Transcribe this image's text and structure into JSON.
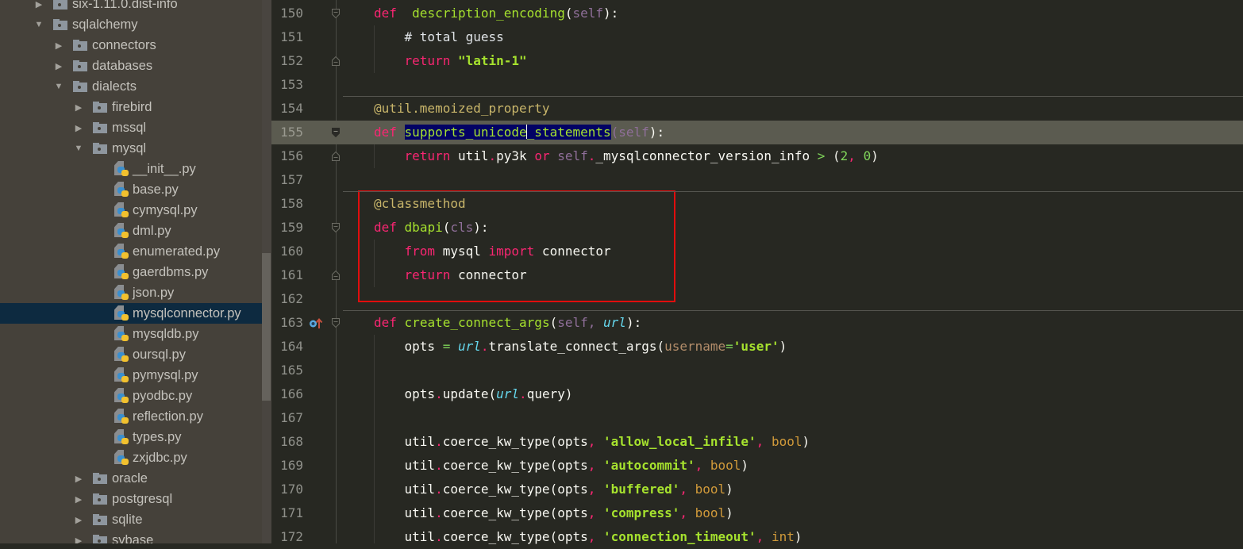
{
  "project_tree": {
    "items": [
      {
        "label": "six-1.11.0.dist-info",
        "type": "folder",
        "expanded": false,
        "depth": 0
      },
      {
        "label": "sqlalchemy",
        "type": "folder",
        "expanded": true,
        "depth": 0
      },
      {
        "label": "connectors",
        "type": "folder",
        "expanded": false,
        "depth": 1
      },
      {
        "label": "databases",
        "type": "folder",
        "expanded": false,
        "depth": 1
      },
      {
        "label": "dialects",
        "type": "folder",
        "expanded": true,
        "depth": 1
      },
      {
        "label": "firebird",
        "type": "folder",
        "expanded": false,
        "depth": 2
      },
      {
        "label": "mssql",
        "type": "folder",
        "expanded": false,
        "depth": 2
      },
      {
        "label": "mysql",
        "type": "folder",
        "expanded": true,
        "depth": 2
      },
      {
        "label": "__init__.py",
        "type": "file",
        "depth": 3
      },
      {
        "label": "base.py",
        "type": "file",
        "depth": 3
      },
      {
        "label": "cymysql.py",
        "type": "file",
        "depth": 3
      },
      {
        "label": "dml.py",
        "type": "file",
        "depth": 3
      },
      {
        "label": "enumerated.py",
        "type": "file",
        "depth": 3
      },
      {
        "label": "gaerdbms.py",
        "type": "file",
        "depth": 3
      },
      {
        "label": "json.py",
        "type": "file",
        "depth": 3
      },
      {
        "label": "mysqlconnector.py",
        "type": "file",
        "depth": 3,
        "selected": true
      },
      {
        "label": "mysqldb.py",
        "type": "file",
        "depth": 3
      },
      {
        "label": "oursql.py",
        "type": "file",
        "depth": 3
      },
      {
        "label": "pymysql.py",
        "type": "file",
        "depth": 3
      },
      {
        "label": "pyodbc.py",
        "type": "file",
        "depth": 3
      },
      {
        "label": "reflection.py",
        "type": "file",
        "depth": 3
      },
      {
        "label": "types.py",
        "type": "file",
        "depth": 3
      },
      {
        "label": "zxjdbc.py",
        "type": "file",
        "depth": 3
      },
      {
        "label": "oracle",
        "type": "folder",
        "expanded": false,
        "depth": 2
      },
      {
        "label": "postgresql",
        "type": "folder",
        "expanded": false,
        "depth": 2
      },
      {
        "label": "sqlite",
        "type": "folder",
        "expanded": false,
        "depth": 2
      },
      {
        "label": "sybase",
        "type": "folder",
        "expanded": false,
        "depth": 2
      }
    ]
  },
  "editor": {
    "current_line": 155,
    "highlight_color": "#e20d0d",
    "lines": [
      {
        "n": "150",
        "tokens": [
          [
            "kw",
            "def"
          ],
          [
            "",
            "  "
          ],
          [
            "fn",
            "description_encoding"
          ],
          [
            "",
            "("
          ],
          [
            "self",
            "self"
          ],
          [
            "",
            "):"
          ]
        ]
      },
      {
        "n": "151",
        "tokens": [
          [
            "",
            "    "
          ],
          [
            "cmt",
            "# total guess"
          ]
        ]
      },
      {
        "n": "152",
        "tokens": [
          [
            "",
            "    "
          ],
          [
            "kw",
            "return"
          ],
          [
            "",
            " "
          ],
          [
            "str",
            "\"latin-1\""
          ]
        ]
      },
      {
        "n": "153",
        "tokens": []
      },
      {
        "n": "154",
        "tokens": [
          [
            "deco",
            "@util.memoized_property"
          ]
        ]
      },
      {
        "n": "155",
        "tokens": [
          [
            "kw",
            "def"
          ],
          [
            "",
            " "
          ],
          [
            "fn sel",
            "supports_unicode"
          ],
          [
            "caret",
            ""
          ],
          [
            "fn sel",
            "_statements"
          ],
          [
            "self",
            "("
          ],
          [
            "self",
            "self"
          ],
          [
            "",
            "):"
          ]
        ]
      },
      {
        "n": "156",
        "tokens": [
          [
            "",
            "    "
          ],
          [
            "kw",
            "return"
          ],
          [
            "",
            " util"
          ],
          [
            "dot",
            "."
          ],
          [
            "",
            "py3k "
          ],
          [
            "kw",
            "or"
          ],
          [
            "",
            " "
          ],
          [
            "self",
            "self"
          ],
          [
            "dot",
            "."
          ],
          [
            "",
            "_mysqlconnector_version_info "
          ],
          [
            "num",
            ">"
          ],
          [
            "",
            " ("
          ],
          [
            "num",
            "2"
          ],
          [
            "dot",
            ","
          ],
          [
            "",
            " "
          ],
          [
            "num",
            "0"
          ],
          [
            "",
            ")"
          ]
        ]
      },
      {
        "n": "157",
        "tokens": []
      },
      {
        "n": "158",
        "tokens": [
          [
            "deco",
            "@classmethod"
          ]
        ]
      },
      {
        "n": "159",
        "tokens": [
          [
            "kw",
            "def"
          ],
          [
            "",
            " "
          ],
          [
            "fn",
            "dbapi"
          ],
          [
            "",
            "("
          ],
          [
            "self",
            "cls"
          ],
          [
            "",
            "):"
          ]
        ]
      },
      {
        "n": "160",
        "tokens": [
          [
            "",
            "    "
          ],
          [
            "kw",
            "from"
          ],
          [
            "",
            " mysql "
          ],
          [
            "kw",
            "import"
          ],
          [
            "",
            " connector"
          ]
        ]
      },
      {
        "n": "161",
        "tokens": [
          [
            "",
            "    "
          ],
          [
            "kw",
            "return"
          ],
          [
            "",
            " connector"
          ]
        ]
      },
      {
        "n": "162",
        "tokens": []
      },
      {
        "n": "163",
        "tokens": [
          [
            "kw",
            "def"
          ],
          [
            "",
            " "
          ],
          [
            "fn",
            "create_connect_args"
          ],
          [
            "",
            "("
          ],
          [
            "self",
            "self"
          ],
          [
            "self",
            ","
          ],
          [
            "",
            " "
          ],
          [
            "param",
            "url"
          ],
          [
            "",
            "):"
          ]
        ]
      },
      {
        "n": "164",
        "tokens": [
          [
            "",
            "    opts "
          ],
          [
            "num",
            "="
          ],
          [
            "",
            " "
          ],
          [
            "param",
            "url"
          ],
          [
            "dot",
            "."
          ],
          [
            "",
            "translate_connect_args("
          ],
          [
            "kwarg",
            "username"
          ],
          [
            "num",
            "="
          ],
          [
            "str",
            "'user'"
          ],
          [
            "",
            ")"
          ]
        ]
      },
      {
        "n": "165",
        "tokens": []
      },
      {
        "n": "166",
        "tokens": [
          [
            "",
            "    opts"
          ],
          [
            "dot",
            "."
          ],
          [
            "",
            "update("
          ],
          [
            "param",
            "url"
          ],
          [
            "dot",
            "."
          ],
          [
            "",
            "query)"
          ]
        ]
      },
      {
        "n": "167",
        "tokens": []
      },
      {
        "n": "168",
        "tokens": [
          [
            "",
            "    util"
          ],
          [
            "dot",
            "."
          ],
          [
            "",
            "coerce_kw_type(opts"
          ],
          [
            "dot",
            ","
          ],
          [
            "",
            " "
          ],
          [
            "str",
            "'allow_local_infile'"
          ],
          [
            "dot",
            ","
          ],
          [
            "",
            " "
          ],
          [
            "builtin",
            "bool"
          ],
          [
            "",
            ")"
          ]
        ]
      },
      {
        "n": "169",
        "tokens": [
          [
            "",
            "    util"
          ],
          [
            "dot",
            "."
          ],
          [
            "",
            "coerce_kw_type(opts"
          ],
          [
            "dot",
            ","
          ],
          [
            "",
            " "
          ],
          [
            "str",
            "'autocommit'"
          ],
          [
            "dot",
            ","
          ],
          [
            "",
            " "
          ],
          [
            "builtin",
            "bool"
          ],
          [
            "",
            ")"
          ]
        ]
      },
      {
        "n": "170",
        "tokens": [
          [
            "",
            "    util"
          ],
          [
            "dot",
            "."
          ],
          [
            "",
            "coerce_kw_type(opts"
          ],
          [
            "dot",
            ","
          ],
          [
            "",
            " "
          ],
          [
            "str",
            "'buffered'"
          ],
          [
            "dot",
            ","
          ],
          [
            "",
            " "
          ],
          [
            "builtin",
            "bool"
          ],
          [
            "",
            ")"
          ]
        ]
      },
      {
        "n": "171",
        "tokens": [
          [
            "",
            "    util"
          ],
          [
            "dot",
            "."
          ],
          [
            "",
            "coerce_kw_type(opts"
          ],
          [
            "dot",
            ","
          ],
          [
            "",
            " "
          ],
          [
            "str",
            "'compress'"
          ],
          [
            "dot",
            ","
          ],
          [
            "",
            " "
          ],
          [
            "builtin",
            "bool"
          ],
          [
            "",
            ")"
          ]
        ]
      },
      {
        "n": "172",
        "tokens": [
          [
            "",
            "    util"
          ],
          [
            "dot",
            "."
          ],
          [
            "",
            "coerce_kw_type(opts"
          ],
          [
            "dot",
            ","
          ],
          [
            "",
            " "
          ],
          [
            "str",
            "'connection_timeout'"
          ],
          [
            "dot",
            ","
          ],
          [
            "",
            " "
          ],
          [
            "builtin",
            "int"
          ],
          [
            "",
            ")"
          ]
        ]
      }
    ],
    "fold_markers": {
      "150": "open",
      "152": "close",
      "155": "open-current",
      "156": "close",
      "159": "open",
      "161": "close",
      "163": "open"
    },
    "separators_after": [
      "153",
      "157",
      "162"
    ],
    "override_icon_line": "163"
  }
}
